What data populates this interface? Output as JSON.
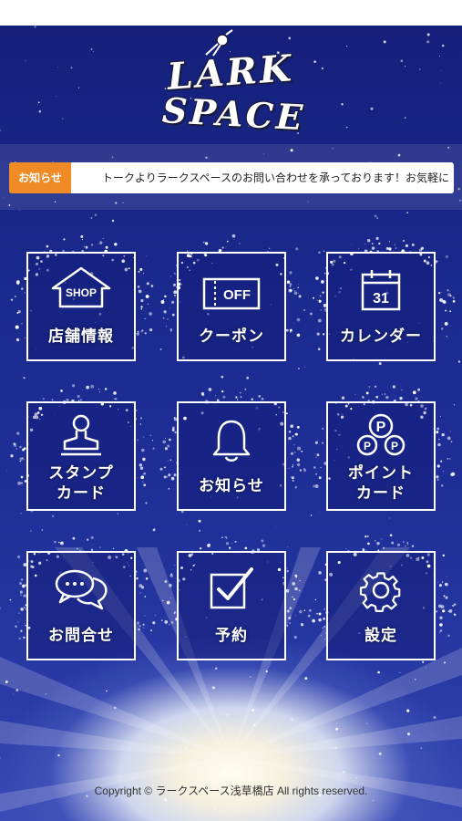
{
  "app": {
    "logo_line1": "LARK",
    "logo_line2": "SPACE"
  },
  "news": {
    "label": "お知らせ",
    "ticker": "トークよりラークスペースのお問い合わせを承っております！お気軽に"
  },
  "menu": [
    {
      "label": "店舗情報",
      "icon": "shop-icon",
      "icon_text": "SHOP"
    },
    {
      "label": "クーポン",
      "icon": "coupon-icon",
      "icon_text": "OFF"
    },
    {
      "label": "カレンダー",
      "icon": "calendar-icon",
      "icon_text": "31"
    },
    {
      "label": "スタンプ\nカード",
      "icon": "stamp-icon"
    },
    {
      "label": "お知らせ",
      "icon": "bell-icon"
    },
    {
      "label": "ポイント\nカード",
      "icon": "point-icon",
      "icon_text": "P"
    },
    {
      "label": "お問合せ",
      "icon": "chat-icon"
    },
    {
      "label": "予約",
      "icon": "checkbox-icon"
    },
    {
      "label": "設定",
      "icon": "gear-icon"
    }
  ],
  "footer": {
    "copyright": "Copyright © ラークスペース浅草橋店 All rights reserved."
  },
  "colors": {
    "background": "#1b2a8f",
    "news_label": "#f08a25",
    "tile_border": "#ffffff"
  }
}
